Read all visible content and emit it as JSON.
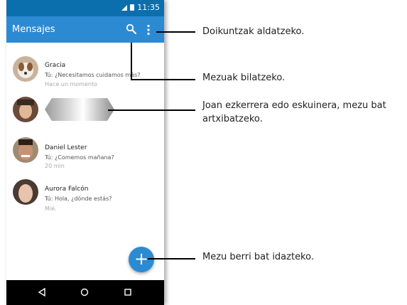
{
  "status_bar": {
    "time": "11:35"
  },
  "app_bar": {
    "title": "Mensajes"
  },
  "conversations": [
    {
      "name": "Gracia",
      "preview": "Tú: ¿Necesitamos cuidamos más?",
      "time": "Hace un momento"
    },
    {
      "name": "",
      "preview": "",
      "time": ""
    },
    {
      "name": "Daniel Lester",
      "preview": "Tú: ¿Comemos mañana?",
      "time": "20 min"
    },
    {
      "name": "Aurora Falcón",
      "preview": "Tú: Hola, ¿dónde estás?",
      "time": "Mié."
    }
  ],
  "fab": {
    "label": "+"
  },
  "callouts": {
    "menu": "Doikuntzak aldatzeko.",
    "search": "Mezuak bilatzeko.",
    "swipe_line1": "Joan ezkerrera edo eskuinera, mezu bat",
    "swipe_line2": "artxibatzeko.",
    "new": "Mezu berri bat idazteko."
  },
  "colors": {
    "status_bar": "#0b6fae",
    "app_bar": "#2c8ad3",
    "fab": "#2c8ad3"
  }
}
